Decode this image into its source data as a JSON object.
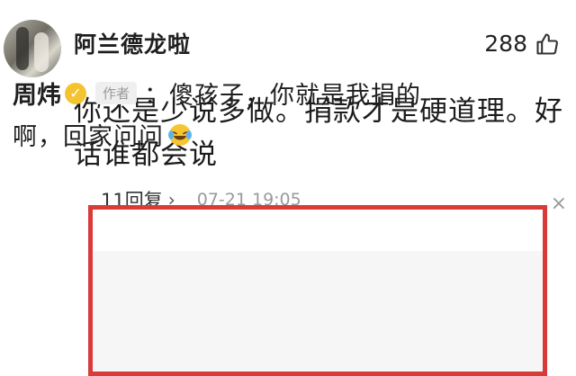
{
  "comment": {
    "username": "阿兰德龙啦",
    "like_count": "288",
    "text": "你还是少说多做。捐款才是硬道理。好话谁都会说",
    "reply_count_label": "11回复",
    "timestamp": "07-21 19:05"
  },
  "reply": {
    "author": "周炜",
    "author_tag": "作者",
    "text_line1": "：傻孩子，你就是我捐的",
    "text_line2": "啊，回家问问"
  },
  "colors": {
    "highlight_border": "#d93a3a",
    "verified_badge": "#f4c430"
  },
  "icons": {
    "like": "thumbs-up-icon",
    "verified": "verified-badge-icon",
    "emoji": "laughing-crying-emoji-icon",
    "chevron": "chevron-right-icon",
    "close": "close-icon"
  }
}
